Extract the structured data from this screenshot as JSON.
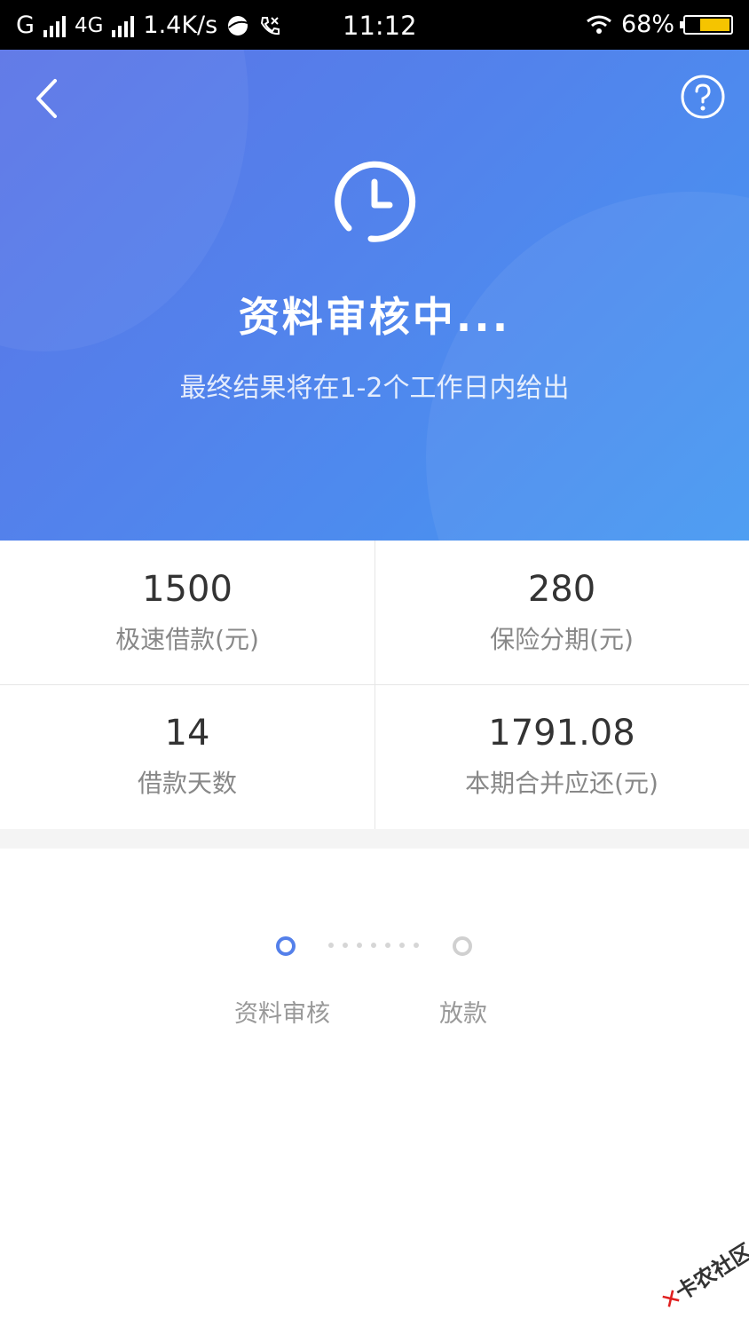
{
  "status_bar": {
    "carrier1": "G",
    "carrier2": "4G",
    "speed": "1.4K/s",
    "time": "11:12",
    "battery": "68%",
    "icons": [
      "signal-icon",
      "browser-icon",
      "missed-call-icon",
      "wifi-icon",
      "battery-icon"
    ]
  },
  "header": {
    "title": "资料审核中...",
    "subtitle": "最终结果将在1-2个工作日内给出",
    "icons": [
      "back-arrow-icon",
      "help-icon",
      "clock-icon"
    ],
    "colors": {
      "gradient_start": "#5b74e6",
      "gradient_end": "#4598f2"
    }
  },
  "stats": [
    {
      "value": "1500",
      "label": "极速借款(元)"
    },
    {
      "value": "280",
      "label": "保险分期(元)"
    },
    {
      "value": "14",
      "label": "借款天数"
    },
    {
      "value": "1791.08",
      "label": "本期合并应还(元)"
    }
  ],
  "progress": {
    "steps": [
      {
        "label": "资料审核",
        "state": "active"
      },
      {
        "label": "放款",
        "state": "pending"
      }
    ],
    "colors": {
      "active": "#5480ea",
      "pending": "#d0d0d0"
    }
  },
  "watermark": {
    "text": "卡农社区"
  }
}
